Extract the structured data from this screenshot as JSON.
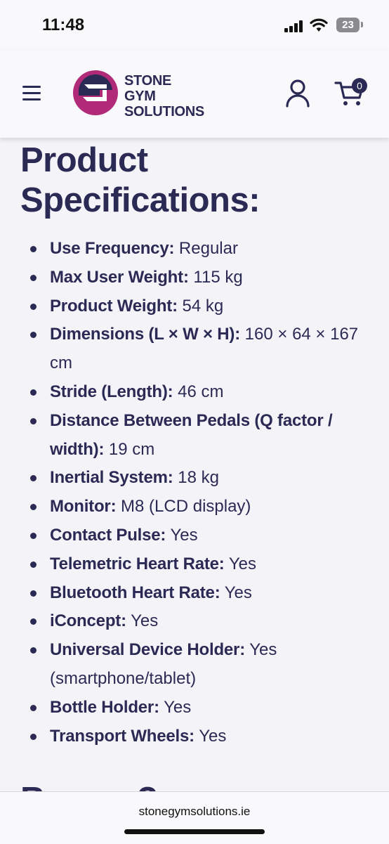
{
  "status_bar": {
    "time": "11:48",
    "battery": "23",
    "icons": [
      "cellular-signal-icon",
      "wifi-icon",
      "battery-icon"
    ]
  },
  "header": {
    "brand_line1": "STONE",
    "brand_line2": "GYM",
    "brand_line3": "SOLUTIONS",
    "cart_count": "0",
    "icons": [
      "hamburger-menu-icon",
      "account-icon",
      "cart-icon"
    ],
    "colors": {
      "brand_navy": "#2b2a55",
      "brand_magenta": "#b02a78"
    }
  },
  "main": {
    "title_line1": "Product",
    "title_line2": "Specifications:",
    "specs": [
      {
        "label": "Use Frequency:",
        "value": " Regular"
      },
      {
        "label": "Max User Weight:",
        "value": " 115 kg"
      },
      {
        "label": "Product Weight:",
        "value": " 54 kg"
      },
      {
        "label": "Dimensions (L × W × H):",
        "value": " 160 × 64 × 167 cm"
      },
      {
        "label": "Stride (Length):",
        "value": " 46 cm"
      },
      {
        "label": "Distance Between Pedals (Q factor / width):",
        "value": " 19 cm"
      },
      {
        "label": "Inertial System:",
        "value": " 18 kg"
      },
      {
        "label": "Monitor:",
        "value": " M8 (LCD display)"
      },
      {
        "label": "Contact Pulse:",
        "value": " Yes"
      },
      {
        "label": "Telemetric Heart Rate:",
        "value": " Yes"
      },
      {
        "label": "Bluetooth Heart Rate:",
        "value": " Yes"
      },
      {
        "label": "iConcept:",
        "value": " Yes"
      },
      {
        "label": "Universal Device Holder:",
        "value": " Yes (smartphone/tablet)"
      },
      {
        "label": "Bottle Holder:",
        "value": " Yes"
      },
      {
        "label": "Transport Wheels:",
        "value": " Yes"
      }
    ],
    "next_heading_partial": "Bonus ?"
  },
  "browser": {
    "url": "stonegymsolutions.ie"
  }
}
